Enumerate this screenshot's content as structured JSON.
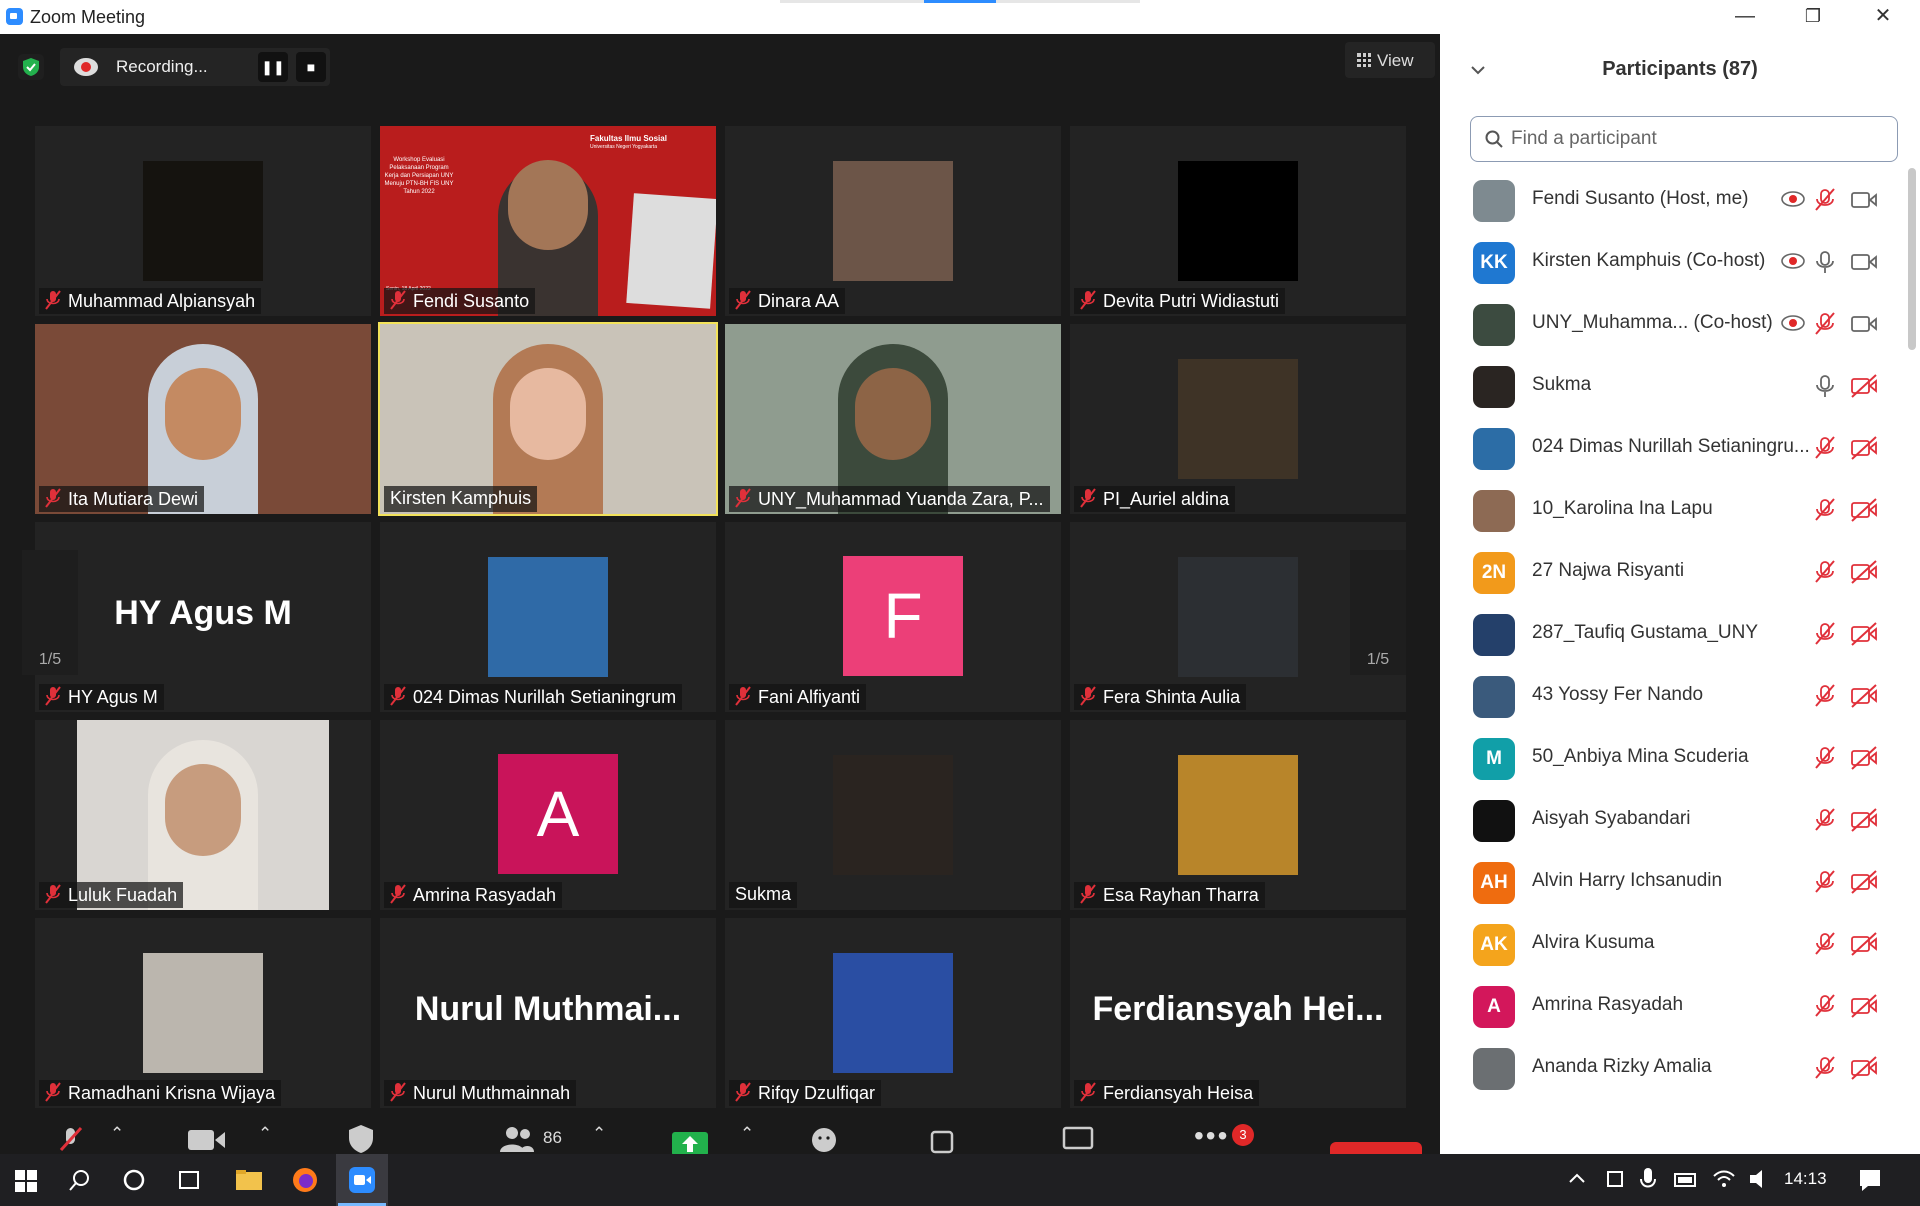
{
  "window": {
    "title": "Zoom Meeting",
    "minimize": "—",
    "restore": "❐",
    "close": "✕"
  },
  "meeting": {
    "recording_label": "Recording...",
    "view_label": "View",
    "page_indicator": "1/5",
    "tiles": [
      {
        "name": "Muhammad Alpiansyah",
        "muted": true
      },
      {
        "name": "Fendi Susanto",
        "muted": true,
        "slide_header": "Fakultas Ilmu Sosial",
        "slide_sub": "Universitas Negeri Yogyakarta",
        "slide_title": "Workshop Evaluasi Pelaksanaan Program Kerja dan Persiapan UNY Menuju PTN-BH FIS UNY Tahun 2022",
        "slide_date": "Senin, 18 April 2022"
      },
      {
        "name": "Dinara AA",
        "muted": true
      },
      {
        "name": "Devita Putri Widiastuti",
        "muted": true
      },
      {
        "name": "Ita Mutiara Dewi",
        "muted": true
      },
      {
        "name": "Kirsten Kamphuis",
        "muted": false,
        "active": true
      },
      {
        "name": "UNY_Muhammad Yuanda Zara, P...",
        "muted": true
      },
      {
        "name": "PI_Auriel aldina",
        "muted": true
      },
      {
        "name": "HY  Agus M",
        "muted": true,
        "big": "HY  Agus M"
      },
      {
        "name": "024 Dimas Nurillah Setianingrum",
        "muted": true
      },
      {
        "name": "Fani Alfiyanti",
        "muted": true,
        "letter": "F"
      },
      {
        "name": "Fera Shinta Aulia",
        "muted": true
      },
      {
        "name": "Luluk Fuadah",
        "muted": true
      },
      {
        "name": "Amrina Rasyadah",
        "muted": true,
        "letter": "A"
      },
      {
        "name": "Sukma",
        "muted": false
      },
      {
        "name": "Esa Rayhan Tharra",
        "muted": true
      },
      {
        "name": "Ramadhani Krisna Wijaya",
        "muted": true
      },
      {
        "name": "Nurul Muthmainnah",
        "muted": true,
        "big": "Nurul  Muthmai..."
      },
      {
        "name": "Rifqy Dzulfiqar",
        "muted": true
      },
      {
        "name": "Ferdiansyah Heisa",
        "muted": true,
        "big": "Ferdiansyah  Hei..."
      }
    ]
  },
  "toolbar": {
    "participants_count": "86",
    "chat_badge": "3"
  },
  "panel": {
    "title": "Participants (87)",
    "search_placeholder": "Find a participant",
    "participants": [
      {
        "name": "Fendi Susanto (Host, me)",
        "initials": "",
        "color": "#7e8a90"
      },
      {
        "name": "Kirsten Kamphuis (Co-host)",
        "initials": "KK",
        "color": "#1f78d1"
      },
      {
        "name": "UNY_Muhamma...  (Co-host)",
        "initials": "",
        "color": "#3c4b40"
      },
      {
        "name": "Sukma",
        "initials": "",
        "color": "#2a2522"
      },
      {
        "name": "024 Dimas Nurillah Setianingru...",
        "initials": "",
        "color": "#2c6da6"
      },
      {
        "name": "10_Karolina Ina Lapu",
        "initials": "",
        "color": "#8d6a54"
      },
      {
        "name": "27 Najwa Risyanti",
        "initials": "2N",
        "color": "#f29a1b"
      },
      {
        "name": "287_Taufiq Gustama_UNY",
        "initials": "",
        "color": "#24406a"
      },
      {
        "name": "43 Yossy Fer Nando",
        "initials": "",
        "color": "#3a5a7c"
      },
      {
        "name": "50_Anbiya Mina Scuderia",
        "initials": "M",
        "color": "#119fa8"
      },
      {
        "name": "Aisyah Syabandari",
        "initials": "",
        "color": "#111111"
      },
      {
        "name": "Alvin Harry Ichsanudin",
        "initials": "AH",
        "color": "#ef6c0f"
      },
      {
        "name": "Alvira Kusuma",
        "initials": "AK",
        "color": "#f4a41c"
      },
      {
        "name": "Amrina Rasyadah",
        "initials": "A",
        "color": "#d3175b"
      },
      {
        "name": "Ananda Rizky Amalia",
        "initials": "",
        "color": "#6b6f72"
      }
    ]
  },
  "taskbar": {
    "time": "14:13"
  },
  "colors": {
    "accent": "#2d8cff",
    "muted_red": "#e0303a",
    "active_speaker": "#f2e25a"
  }
}
